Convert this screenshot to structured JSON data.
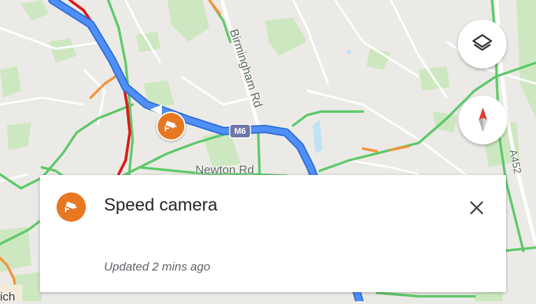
{
  "map": {
    "labels": {
      "birmingham_rd": "Birmingham Rd",
      "newton_rd": "Newton Rd",
      "a452": "A452",
      "partial_place": "ich"
    },
    "motorway_shield": "M6",
    "colors": {
      "background": "#eceae6",
      "park": "#cde8c0",
      "road_clear": "#5dc96a",
      "road_slow": "#f5923a",
      "road_heavy": "#d91d1d",
      "route": "#4f8ff7",
      "route_outline": "#2f6fd6",
      "camera": "#e87722"
    },
    "markers": [
      {
        "type": "speed-camera",
        "icon": "speed-camera-icon"
      }
    ]
  },
  "controls": {
    "layers_icon": "layers-icon",
    "compass_icon": "compass-icon"
  },
  "card": {
    "icon": "speed-camera-icon",
    "title": "Speed camera",
    "updated": "Updated 2 mins ago",
    "close_icon": "close-icon"
  }
}
